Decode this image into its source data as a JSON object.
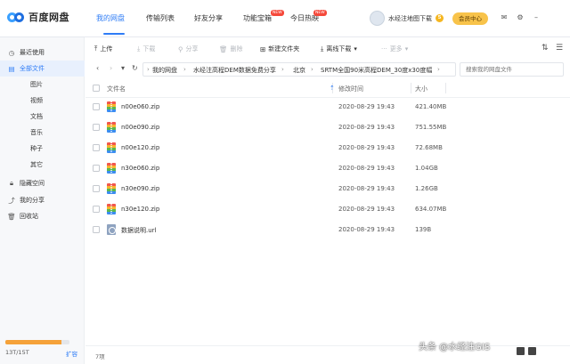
{
  "app": {
    "name": "百度网盘"
  },
  "nav": {
    "tabs": [
      {
        "label": "我的网盘",
        "active": true
      },
      {
        "label": "传输列表"
      },
      {
        "label": "好友分享"
      },
      {
        "label": "功能宝箱",
        "badge": "NEW"
      },
      {
        "label": "今日热映",
        "badge": "NEW"
      }
    ]
  },
  "user": {
    "name": "水经注地图下载",
    "coin_icon": "5",
    "vip_label": "会员中心"
  },
  "sidebar": {
    "items": [
      {
        "label": "最近使用",
        "icon": "clock-icon"
      },
      {
        "label": "全部文件",
        "icon": "file-icon",
        "active": true
      },
      {
        "label": "图片"
      },
      {
        "label": "视频"
      },
      {
        "label": "文档"
      },
      {
        "label": "音乐"
      },
      {
        "label": "种子"
      },
      {
        "label": "其它"
      },
      {
        "label": "隐藏空间",
        "icon": "lock-icon"
      },
      {
        "label": "我的分享",
        "icon": "share-icon"
      },
      {
        "label": "回收站",
        "icon": "trash-icon"
      }
    ],
    "quota": {
      "text": "13T/15T",
      "used_fraction": 0.87,
      "expand_label": "扩容"
    }
  },
  "toolbar": {
    "upload": "上传",
    "download": "下载",
    "share": "分享",
    "delete": "删除",
    "new_folder": "新建文件夹",
    "offline_download": "离线下载",
    "more": "更多"
  },
  "path": {
    "crumbs": [
      "我的网盘",
      "水经注高程DEM数据免费分享",
      "北京",
      "SRTM全国90米高程DEM_30度x30度幅"
    ],
    "search_placeholder": "搜索我的网盘文件"
  },
  "list": {
    "headers": {
      "name": "文件名",
      "modified": "修改时间",
      "size": "大小"
    },
    "rows": [
      {
        "name": "n00e060.zip",
        "modified": "2020-08-29 19:43",
        "size": "421.40MB",
        "type": "zip"
      },
      {
        "name": "n00e090.zip",
        "modified": "2020-08-29 19:43",
        "size": "751.55MB",
        "type": "zip"
      },
      {
        "name": "n00e120.zip",
        "modified": "2020-08-29 19:43",
        "size": "72.68MB",
        "type": "zip"
      },
      {
        "name": "n30e060.zip",
        "modified": "2020-08-29 19:43",
        "size": "1.04GB",
        "type": "zip"
      },
      {
        "name": "n30e090.zip",
        "modified": "2020-08-29 19:43",
        "size": "1.26GB",
        "type": "zip"
      },
      {
        "name": "n30e120.zip",
        "modified": "2020-08-29 19:43",
        "size": "634.07MB",
        "type": "zip"
      },
      {
        "name": "数据说明.url",
        "modified": "2020-08-29 19:43",
        "size": "139B",
        "type": "url"
      }
    ]
  },
  "footer": {
    "count": "7项"
  },
  "watermark": "头条 @水经注GIS"
}
